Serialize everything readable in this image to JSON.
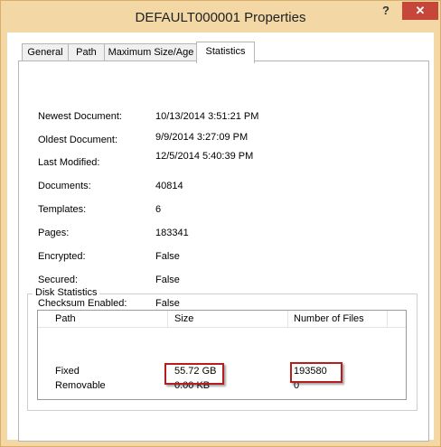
{
  "window": {
    "title": "DEFAULT000001 Properties",
    "help_label": "?",
    "close_label": "✕"
  },
  "tabs": [
    "General",
    "Path",
    "Maximum Size/Age",
    "Statistics"
  ],
  "active_tab": "Statistics",
  "stats": [
    {
      "label": "Newest Document:",
      "value": "10/13/2014 3:51:21 PM"
    },
    {
      "label": "Oldest Document:",
      "value": "9/9/2014 3:27:09 PM"
    },
    {
      "label": "Last Modified:",
      "value": "12/5/2014 5:40:39 PM"
    },
    {
      "label": "Documents:",
      "value": "40814"
    },
    {
      "label": "Templates:",
      "value": "6"
    },
    {
      "label": "Pages:",
      "value": "183341"
    },
    {
      "label": "Encrypted:",
      "value": "False"
    },
    {
      "label": "Secured:",
      "value": "False"
    },
    {
      "label": "Checksum Enabled:",
      "value": "False"
    }
  ],
  "disk_statistics": {
    "legend": "Disk Statistics",
    "columns": [
      "Path",
      "Size",
      "Number of Files"
    ],
    "rows": [
      {
        "path": "Fixed",
        "size": "55.72 GB",
        "files": "193580"
      },
      {
        "path": "Removable",
        "size": "0.00 KB",
        "files": "0"
      }
    ]
  },
  "colors": {
    "frame": "#f3d8a6",
    "close_button": "#c7463a",
    "highlight": "#b81d1d"
  }
}
